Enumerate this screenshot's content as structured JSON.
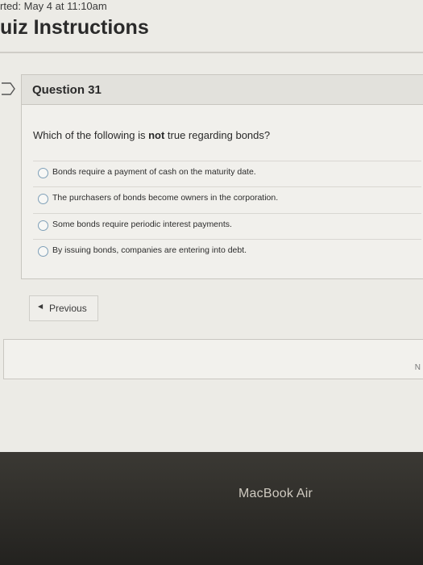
{
  "header": {
    "started": "rted: May 4 at 11:10am",
    "title": "uiz Instructions"
  },
  "question": {
    "title": "Question 31",
    "text_before": "Which of the following is ",
    "text_emphasis": "not",
    "text_after": " true regarding bonds?"
  },
  "answers": [
    {
      "label": "Bonds require a payment of cash on the maturity date."
    },
    {
      "label": "The purchasers of bonds become owners in the corporation."
    },
    {
      "label": "Some bonds require periodic interest payments."
    },
    {
      "label": "By issuing bonds, companies are entering into debt."
    }
  ],
  "navigation": {
    "previous_label": "Previous",
    "previous_icon": "chevron-left-icon"
  },
  "device": {
    "label": "MacBook Air"
  },
  "edge_glyph": "N"
}
